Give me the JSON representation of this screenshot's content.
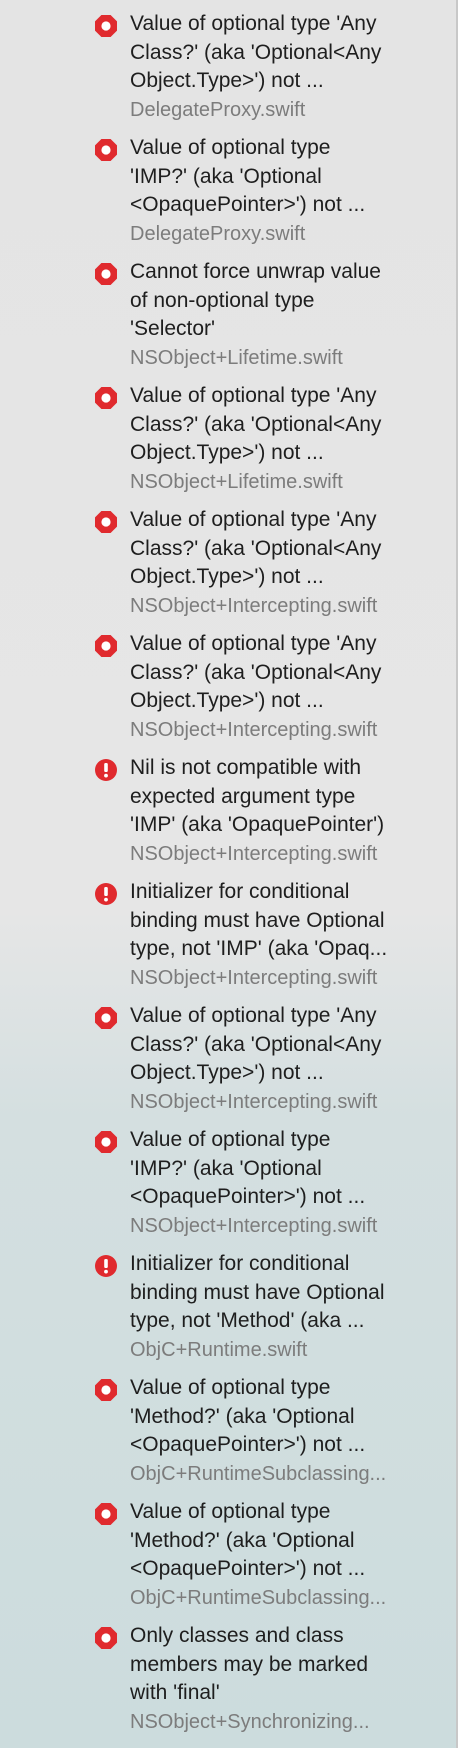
{
  "issues": [
    {
      "kind": "error",
      "icon": "error-octagon-icon",
      "lines": [
        "Value of optional type 'Any",
        "Class?' (aka 'Optional<Any",
        "Object.Type>') not ..."
      ],
      "file": "DelegateProxy.swift"
    },
    {
      "kind": "error",
      "icon": "error-octagon-icon",
      "lines": [
        "Value of optional type",
        "'IMP?' (aka 'Optional",
        "<OpaquePointer>') not ..."
      ],
      "file": "DelegateProxy.swift"
    },
    {
      "kind": "error",
      "icon": "error-octagon-icon",
      "lines": [
        "Cannot force unwrap value",
        "of non-optional type",
        "'Selector'"
      ],
      "file": "NSObject+Lifetime.swift"
    },
    {
      "kind": "error",
      "icon": "error-octagon-icon",
      "lines": [
        "Value of optional type 'Any",
        "Class?' (aka 'Optional<Any",
        "Object.Type>') not ..."
      ],
      "file": "NSObject+Lifetime.swift"
    },
    {
      "kind": "error",
      "icon": "error-octagon-icon",
      "lines": [
        "Value of optional type 'Any",
        "Class?' (aka 'Optional<Any",
        "Object.Type>') not ..."
      ],
      "file": "NSObject+Intercepting.swift"
    },
    {
      "kind": "error",
      "icon": "error-octagon-icon",
      "lines": [
        "Value of optional type 'Any",
        "Class?' (aka 'Optional<Any",
        "Object.Type>') not ..."
      ],
      "file": "NSObject+Intercepting.swift"
    },
    {
      "kind": "fatal",
      "icon": "error-exclamation-icon",
      "lines": [
        "Nil is not compatible with",
        "expected argument type",
        "'IMP' (aka 'OpaquePointer')"
      ],
      "file": "NSObject+Intercepting.swift"
    },
    {
      "kind": "fatal",
      "icon": "error-exclamation-icon",
      "lines": [
        "Initializer for conditional",
        "binding must have Optional",
        "type, not 'IMP' (aka 'Opaq..."
      ],
      "file": "NSObject+Intercepting.swift"
    },
    {
      "kind": "error",
      "icon": "error-octagon-icon",
      "lines": [
        "Value of optional type 'Any",
        "Class?' (aka 'Optional<Any",
        "Object.Type>') not ..."
      ],
      "file": "NSObject+Intercepting.swift"
    },
    {
      "kind": "error",
      "icon": "error-octagon-icon",
      "lines": [
        "Value of optional type",
        "'IMP?' (aka 'Optional",
        "<OpaquePointer>') not ..."
      ],
      "file": "NSObject+Intercepting.swift"
    },
    {
      "kind": "fatal",
      "icon": "error-exclamation-icon",
      "lines": [
        "Initializer for conditional",
        "binding must have Optional",
        "type, not 'Method' (aka ..."
      ],
      "file": "ObjC+Runtime.swift"
    },
    {
      "kind": "error",
      "icon": "error-octagon-icon",
      "lines": [
        "Value of optional type",
        "'Method?' (aka 'Optional",
        "<OpaquePointer>') not ..."
      ],
      "file": "ObjC+RuntimeSubclassing..."
    },
    {
      "kind": "error",
      "icon": "error-octagon-icon",
      "lines": [
        "Value of optional type",
        "'Method?' (aka 'Optional",
        "<OpaquePointer>') not ..."
      ],
      "file": "ObjC+RuntimeSubclassing..."
    },
    {
      "kind": "error",
      "icon": "error-octagon-icon",
      "lines": [
        "Only classes and class",
        "members may be marked",
        "with 'final'"
      ],
      "file": "NSObject+Synchronizing..."
    }
  ],
  "colors": {
    "error_red": "#e02a2e",
    "message_text": "#1e1e1e",
    "file_text": "#7c7c7c"
  }
}
